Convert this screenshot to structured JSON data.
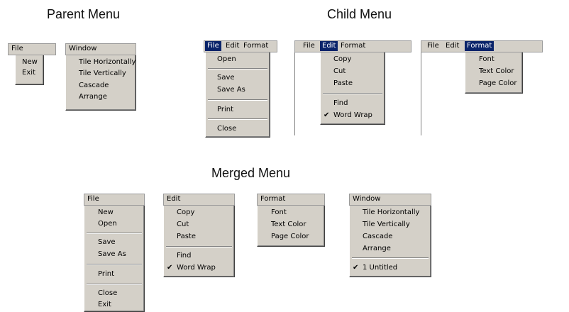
{
  "titles": {
    "parent": "Parent Menu",
    "child": "Child Menu",
    "merged": "Merged Menu"
  },
  "parent": {
    "file": {
      "label": "File",
      "items": [
        "New",
        "Exit"
      ]
    },
    "window": {
      "label": "Window",
      "items": [
        "Tile Horizontally",
        "Tile Vertically",
        "Cascade",
        "Arrange"
      ]
    }
  },
  "child": {
    "menubar": [
      "File",
      "Edit",
      "Format"
    ],
    "file_items": [
      "Open",
      "Save",
      "Save As",
      "Print",
      "Close"
    ],
    "edit_items": [
      "Copy",
      "Cut",
      "Paste",
      "Find",
      "Word Wrap"
    ],
    "format_items": [
      "Font",
      "Text Color",
      "Page Color"
    ]
  },
  "merged": {
    "file": {
      "label": "File",
      "items": [
        "New",
        "Open",
        "Save",
        "Save As",
        "Print",
        "Close",
        "Exit"
      ]
    },
    "edit": {
      "label": "Edit",
      "items": [
        "Copy",
        "Cut",
        "Paste",
        "Find",
        "Word Wrap"
      ]
    },
    "format": {
      "label": "Format",
      "items": [
        "Font",
        "Text Color",
        "Page Color"
      ]
    },
    "window": {
      "label": "Window",
      "items": [
        "Tile Horizontally",
        "Tile Vertically",
        "Cascade",
        "Arrange",
        "1 Untitled"
      ]
    }
  },
  "checkmark": "✔"
}
